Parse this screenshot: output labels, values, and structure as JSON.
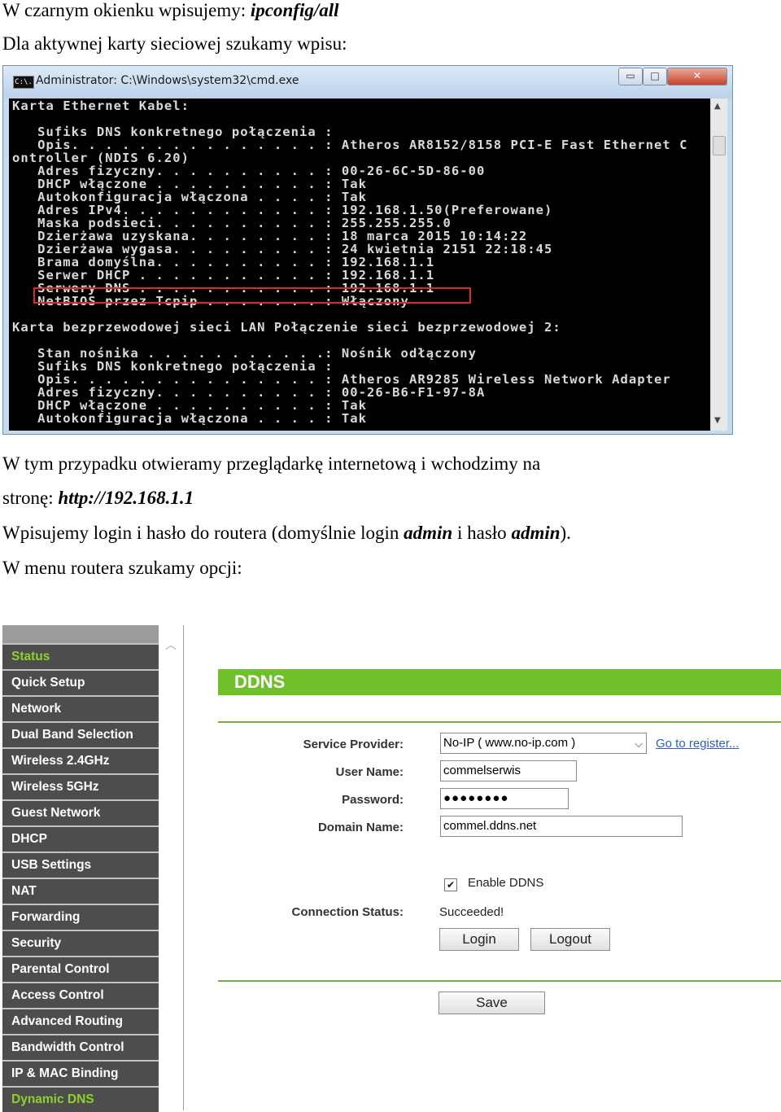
{
  "intro": {
    "line1_text": "W czarnym okienku wpisujemy: ",
    "line1_command": "ipconfig/all",
    "line2_text": "Dla aktywnej karty sieciowej szukamy wpisu:"
  },
  "cmd_window": {
    "icon_text": "C:\\.",
    "title": "Administrator: C:\\Windows\\system32\\cmd.exe",
    "minimize_glyph": "▭",
    "maximize_glyph": "□",
    "close_glyph": "✕",
    "scroll_up_glyph": "▲",
    "scroll_down_glyph": "▼",
    "console_text": "Karta Ethernet Kabel:\n\n   Sufiks DNS konkretnego połączenia :\n   Opis. . . . . . . . . . . . . . . : Atheros AR8152/8158 PCI-E Fast Ethernet C\nontroller (NDIS 6.20)\n   Adres fizyczny. . . . . . . . . . : 00-26-6C-5D-86-00\n   DHCP włączone . . . . . . . . . . : Tak\n   Autokonfiguracja włączona . . . . : Tak\n   Adres IPv4. . . . . . . . . . . . : 192.168.1.50(Preferowane)\n   Maska podsieci. . . . . . . . . . : 255.255.255.0\n   Dzierżawa uzyskana. . . . . . . . : 18 marca 2015 10:14:22\n   Dzierżawa wygasa. . . . . . . . . : 24 kwietnia 2151 22:18:45\n   Brama domyślna. . . . . . . . . . : 192.168.1.1\n   Serwer DHCP . . . . . . . . . . . : 192.168.1.1\n   Serwery DNS . . . . . . . . . . . : 192.168.1.1\n   NetBIOS przez Tcpip . . . . . . . : Włączony\n\nKarta bezprzewodowej sieci LAN Połączenie sieci bezprzewodowej 2:\n\n   Stan nośnika . . . . . . . . . . .: Nośnik odłączony\n   Sufiks DNS konkretnego połączenia :\n   Opis. . . . . . . . . . . . . . . : Atheros AR9285 Wireless Network Adapter\n   Adres fizyczny. . . . . . . . . . : 00-26-B6-F1-97-8A\n   DHCP włączone . . . . . . . . . . : Tak\n   Autokonfiguracja włączona . . . . : Tak"
  },
  "middle": {
    "line1": "W tym przypadku otwieramy przeglądarkę internetową i wchodzimy na",
    "line2_text": "stronę: ",
    "line2_url": "http://192.168.1.1",
    "line3_a": "Wpisujemy login i hasło do routera (domyślnie login ",
    "line3_login": "admin",
    "line3_b": " i hasło ",
    "line3_pass": "admin",
    "line3_c": ").",
    "line4": "W menu routera szukamy opcji:"
  },
  "router": {
    "scroll_up_glyph": "︿",
    "nav": [
      {
        "label": "Status",
        "active": true
      },
      {
        "label": "Quick Setup"
      },
      {
        "label": "Network"
      },
      {
        "label": "Dual Band Selection"
      },
      {
        "label": "Wireless 2.4GHz"
      },
      {
        "label": "Wireless 5GHz"
      },
      {
        "label": "Guest Network"
      },
      {
        "label": "DHCP"
      },
      {
        "label": "USB Settings"
      },
      {
        "label": "NAT"
      },
      {
        "label": "Forwarding"
      },
      {
        "label": "Security"
      },
      {
        "label": "Parental Control"
      },
      {
        "label": "Access Control"
      },
      {
        "label": "Advanced Routing"
      },
      {
        "label": "Bandwidth Control"
      },
      {
        "label": "IP & MAC Binding"
      },
      {
        "label": "Dynamic DNS",
        "active": true
      }
    ],
    "title": "DDNS",
    "service_provider_label": "Service Provider:",
    "service_provider_value": "No-IP ( www.no-ip.com )",
    "chevron_glyph": "⌵",
    "register_link": "Go to register...",
    "username_label": "User Name:",
    "username_value": "commelserwis",
    "password_label": "Password:",
    "password_value": "●●●●●●●●",
    "domain_label": "Domain Name:",
    "domain_value": "commel.ddns.net",
    "enable_ddns_label": "Enable DDNS",
    "enable_ddns_mark": "✔",
    "connection_status_label": "Connection Status:",
    "connection_status_value": "Succeeded!",
    "login_button": "Login",
    "logout_button": "Logout",
    "save_button": "Save",
    "colors": {
      "nav_bg": "#4d4d4d",
      "nav_active": "#8ed12d",
      "header_green": "#70c02e",
      "link": "#2c5fbf"
    }
  }
}
